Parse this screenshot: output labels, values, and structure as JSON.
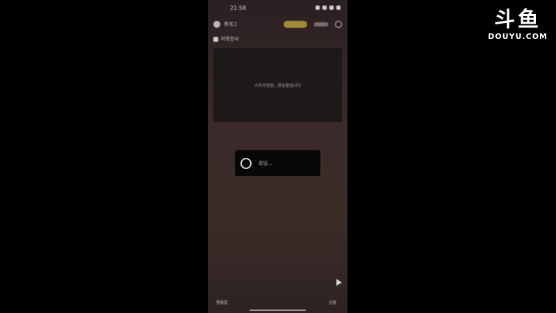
{
  "watermark": {
    "logo_cn": "斗鱼",
    "logo_en": "DOUYU.COM"
  },
  "phone": {
    "status_time": "21:58",
    "topbar_title": "롯데그",
    "subbar_text": "따뜻한사",
    "video_message": "스트리밍된...방송중입니다",
    "loading_text": "로딩...",
    "toolbar": {
      "left": "팬클럽",
      "right": "선물"
    }
  },
  "colors": {
    "background": "#000000",
    "gold_pill": "#a38a39"
  }
}
